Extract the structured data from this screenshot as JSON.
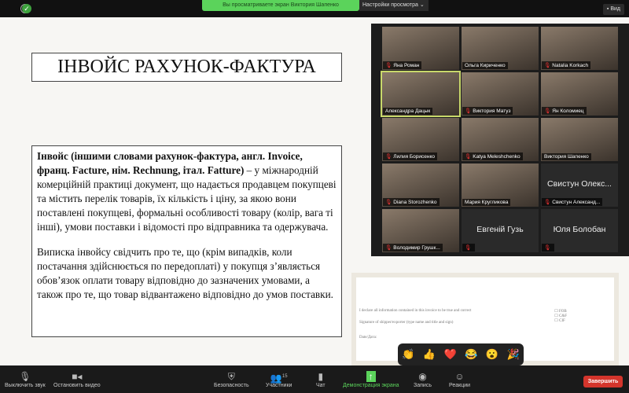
{
  "topbar": {
    "banner": "Вы просматриваете экран Виктория Шапенко",
    "view_options": "Настройки просмотра ⌄",
    "view": "Вид"
  },
  "slide": {
    "title": "ІНВОЙС РАХУНОК-ФАКТУРА",
    "para1_bold": "Інвойс (іншими словами рахунок-фактура, англ. Invoice, франц. Facture,  нім. Rechnung, італ. Fatture)",
    "para1_rest": " – у міжнародній комерційній практиці документ, що надається продавцем покупцеві та містить перелік товарів, їх кількість і ціну, за якою вони поставлені покупцеві, формальні особливості товару (колір, вага ті інші), умови поставки і відомості про відправника та одержувача.",
    "para2": "Виписка інвойсу свідчить про те, що (крім випадків, коли постачання здійснюється по передоплаті) у покупця з’являється обов’язок оплати товару відповідно до зазначених умовами, а також про те, що товар відвантажено відповідно до умов поставки.",
    "form_line1": "I declare all information contained in this invoice to be true and correct",
    "form_line2": "Signature of shipper/exporter (type name and title and sign)",
    "form_line3": "Date/Дата:",
    "form_terms": [
      "FOB",
      "C&F",
      "CIF"
    ]
  },
  "participants": [
    {
      "name": "Яна Роман",
      "muted": true,
      "video": true
    },
    {
      "name": "Ольга Кириченко",
      "muted": false,
      "video": true
    },
    {
      "name": "Natalia Korkach",
      "muted": true,
      "video": true
    },
    {
      "name": "Александра Дацык",
      "muted": false,
      "video": true,
      "active": true
    },
    {
      "name": "Виктория Матуз",
      "muted": true,
      "video": true
    },
    {
      "name": "Ян Коломиец",
      "muted": true,
      "video": true
    },
    {
      "name": "Лилия Борисенко",
      "muted": true,
      "video": true
    },
    {
      "name": "Katya Meleshchenko",
      "muted": true,
      "video": true
    },
    {
      "name": "Виктория Шапенко",
      "muted": false,
      "video": true
    },
    {
      "name": "Diana Storozhenko",
      "muted": true,
      "video": true
    },
    {
      "name": "Мария Кругликова",
      "muted": false,
      "video": true
    },
    {
      "name": "Свистун Александ...",
      "big": "Свистун Олекс...",
      "muted": true,
      "video": false
    },
    {
      "name": "Володимир Грушк...",
      "muted": true,
      "video": true
    },
    {
      "name": "",
      "big": "Евгеній Гузь",
      "muted": true,
      "video": false
    },
    {
      "name": "",
      "big": "Юля Болобан",
      "muted": true,
      "video": false
    }
  ],
  "reactions": [
    "👏",
    "👍",
    "❤️",
    "😂",
    "😮",
    "🎉"
  ],
  "toolbar": {
    "mute": "Выключить звук",
    "video": "Остановить видео",
    "security": "Безопасность",
    "participants": "Участники",
    "participants_count": "15",
    "chat": "Чат",
    "share": "Демонстрация экрана",
    "record": "Запись",
    "reactions": "Реакции",
    "end": "Завершить"
  },
  "colors": {
    "share_green": "#5bd35b",
    "end_red": "#d4352c",
    "active_speaker": "#c8d86a"
  }
}
